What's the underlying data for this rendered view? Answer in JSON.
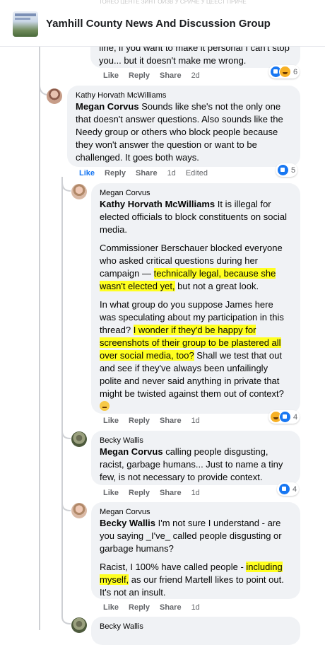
{
  "header": {
    "group_name": "Yamhill County News And Discussion Group",
    "faded_text": "ТОНЕО ЦЕНТЕ ЗИНТ ОИЗВ У СРИЧЕ У ЦЕЕСТ ПРИЧЕ"
  },
  "comments": [
    {
      "id": "c0",
      "author": "",
      "paragraphs": [
        [
          {
            "t": "fine, if you want to make it personal I can't stop you... but it doesn't make me wrong."
          }
        ]
      ],
      "actions": {
        "like": "Like",
        "reply": "Reply",
        "share": "Share",
        "time": "2d",
        "edited": ""
      },
      "reactions": {
        "icons": [
          "like",
          "haha"
        ],
        "count": "6"
      }
    },
    {
      "id": "c1",
      "author": "Kathy Horvath McWilliams",
      "paragraphs": [
        [
          {
            "t": "Megan Corvus",
            "m": true
          },
          {
            "t": " Sounds like she's not the only one that doesn't answer questions. Also sounds like the Needy group or others who block people because they won't answer the question or want to be challenged. It goes both ways."
          }
        ]
      ],
      "actions": {
        "like": "Like",
        "reply": "Reply",
        "share": "Share",
        "time": "1d",
        "edited": "Edited"
      },
      "reactions": {
        "icons": [
          "like"
        ],
        "count": "5"
      }
    },
    {
      "id": "c2",
      "author": "Megan Corvus",
      "paragraphs": [
        [
          {
            "t": "Kathy Horvath McWilliams",
            "m": true
          },
          {
            "t": " It is illegal for elected officials to block constituents on social media."
          }
        ],
        [
          {
            "t": "Commissioner Berschauer blocked everyone who asked critical questions during her campaign — "
          },
          {
            "t": "technically legal, because she wasn't elected yet,",
            "h": true
          },
          {
            "t": " but not a great look."
          }
        ],
        [
          {
            "t": "In what group do you suppose James here was speculating about my participation in this thread? "
          },
          {
            "t": "I wonder if they'd be happy for screenshots of their group to be plastered all over social media, too?",
            "h": true
          },
          {
            "t": " Shall we test that out and see if they've always been unfailingly polite and never said anything in private that might be twisted against them out of context? "
          }
        ]
      ],
      "actions": {
        "like": "Like",
        "reply": "Reply",
        "share": "Share",
        "time": "1d",
        "edited": ""
      },
      "reactions": {
        "icons": [
          "haha",
          "like"
        ],
        "count": "4"
      }
    },
    {
      "id": "c3",
      "author": "Becky Wallis",
      "paragraphs": [
        [
          {
            "t": "Megan Corvus",
            "m": true
          },
          {
            "t": " calling people disgusting, racist, garbage humans... Just to name a tiny few, is not necessary to provide context."
          }
        ]
      ],
      "actions": {
        "like": "Like",
        "reply": "Reply",
        "share": "Share",
        "time": "1d",
        "edited": ""
      },
      "reactions": {
        "icons": [
          "like"
        ],
        "count": "4"
      }
    },
    {
      "id": "c4",
      "author": "Megan Corvus",
      "paragraphs": [
        [
          {
            "t": "Becky Wallis",
            "m": true
          },
          {
            "t": " I'm not sure I understand - are you saying _I've_ called people disgusting or garbage humans?"
          }
        ],
        [
          {
            "t": "Racist, I 100% have called people - "
          },
          {
            "t": "including myself,",
            "h": true
          },
          {
            "t": " as our friend Martell likes to point out. It's not an insult."
          }
        ]
      ],
      "actions": {
        "like": "Like",
        "reply": "Reply",
        "share": "Share",
        "time": "1d",
        "edited": ""
      },
      "reactions": null
    },
    {
      "id": "c5",
      "author": "Becky Wallis",
      "paragraphs": [],
      "actions": null,
      "reactions": null
    }
  ],
  "colors": {
    "highlight": "#ffff20",
    "link_blue": "#1877f2",
    "bubble": "#f0f2f5"
  }
}
